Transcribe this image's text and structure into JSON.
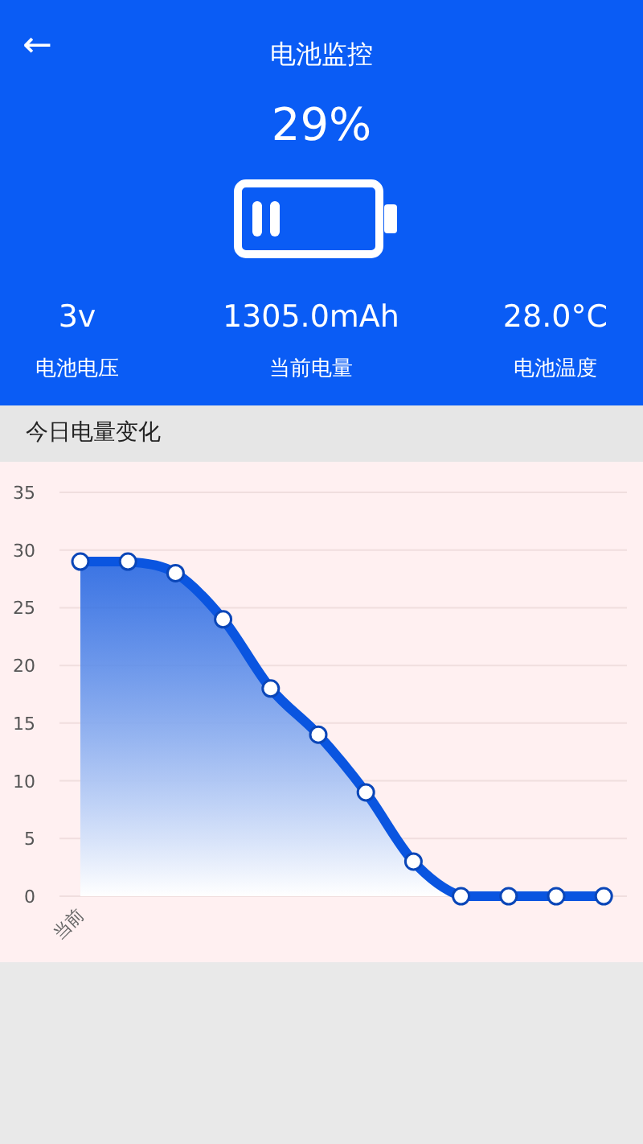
{
  "header": {
    "back": "←",
    "title": "电池监控",
    "percent": "29%"
  },
  "stats": [
    {
      "value": "3v",
      "label": "电池电压"
    },
    {
      "value": "1305.0mAh",
      "label": "当前电量"
    },
    {
      "value": "28.0°C",
      "label": "电池温度"
    }
  ],
  "section_title": "今日电量变化",
  "chart_data": {
    "type": "area",
    "categories": [
      "当前",
      null,
      null,
      null,
      null,
      null,
      null,
      null,
      null,
      null,
      null,
      null
    ],
    "grid": true,
    "series": [
      {
        "color": "#0a55e0",
        "values": [
          29,
          29,
          28,
          24,
          18,
          14,
          9,
          3,
          0,
          0,
          0,
          0
        ]
      }
    ],
    "ylim": [
      0,
      35
    ],
    "yticks": [
      0,
      5,
      10,
      15,
      20,
      25,
      30,
      35
    ]
  }
}
